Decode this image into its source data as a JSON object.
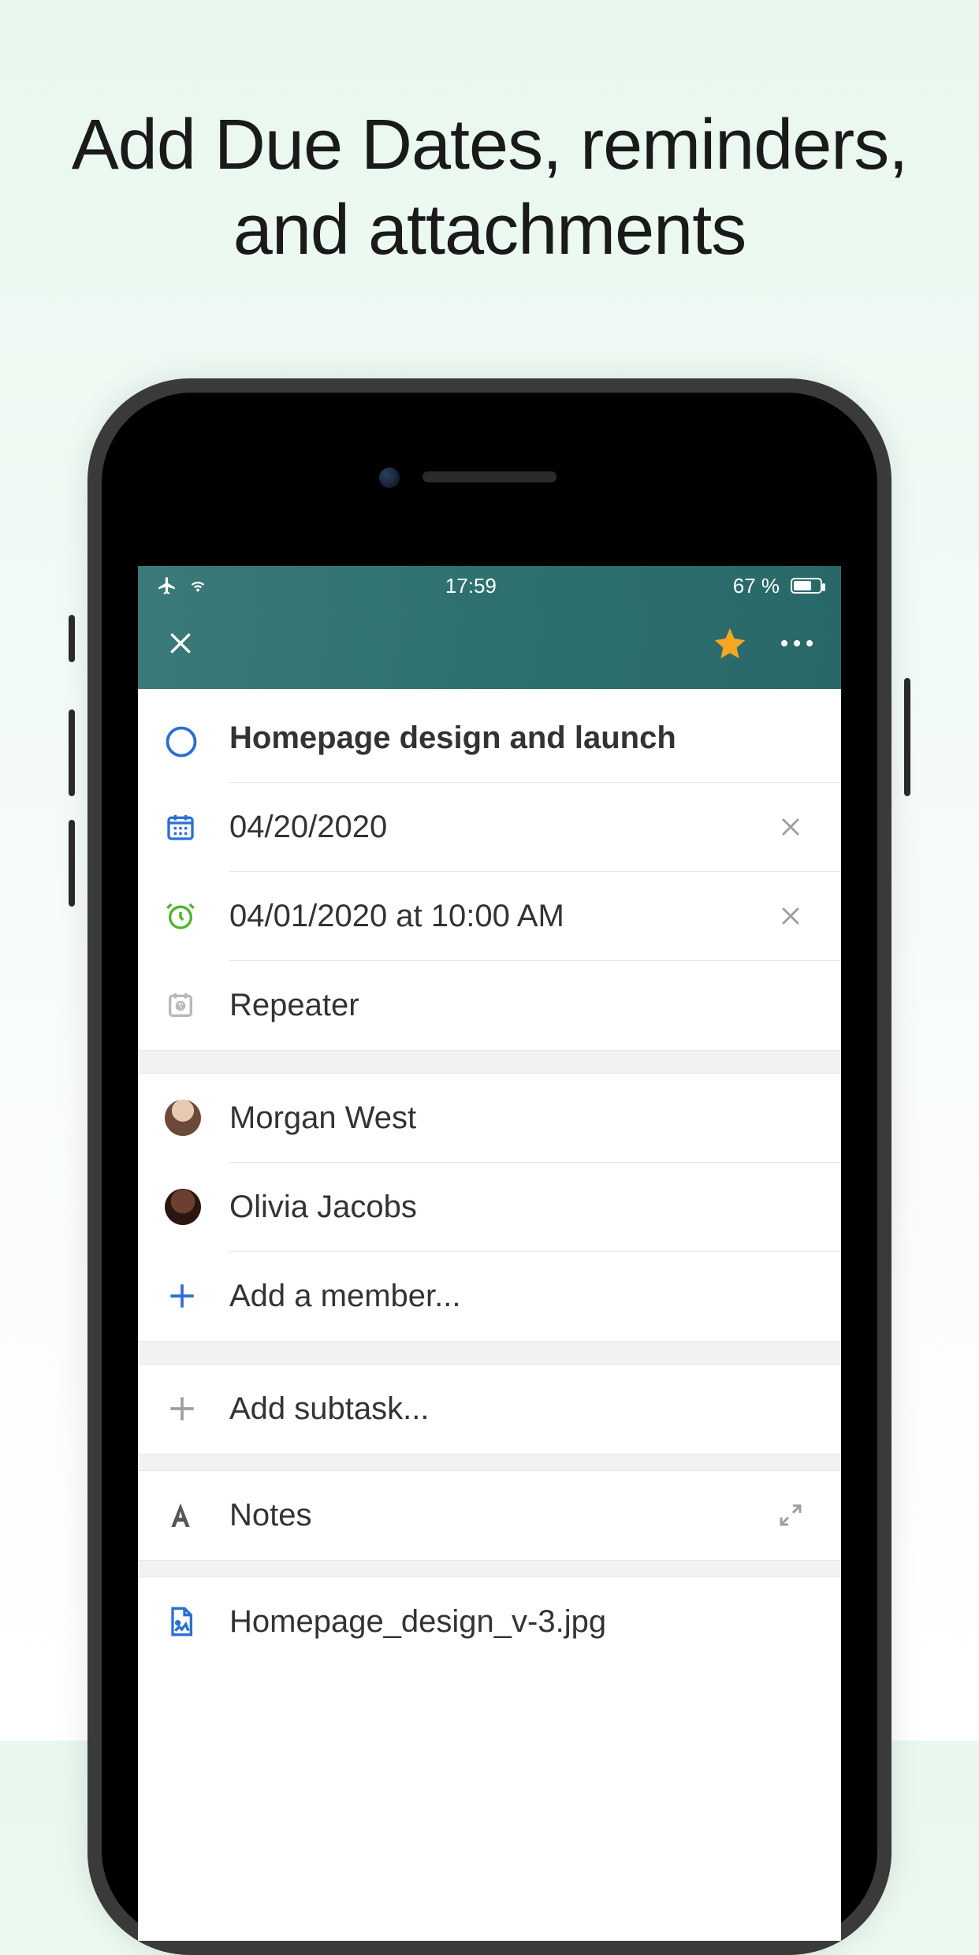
{
  "promo": {
    "line1": "Add Due Dates, reminders,",
    "line2": "and attachments"
  },
  "status": {
    "time": "17:59",
    "battery_label": "67 %"
  },
  "nav": {
    "starred": true
  },
  "task": {
    "title": "Homepage design and launch",
    "due_date": "04/20/2020",
    "reminder": "04/01/2020 at 10:00 AM",
    "repeater_placeholder": "Repeater"
  },
  "members": [
    {
      "name": "Morgan West"
    },
    {
      "name": "Olivia Jacobs"
    }
  ],
  "actions": {
    "add_member": "Add a member...",
    "add_subtask": "Add subtask...",
    "notes": "Notes"
  },
  "attachments": [
    {
      "filename": "Homepage_design_v-3.jpg"
    }
  ],
  "colors": {
    "accent_blue": "#2b6fd6",
    "star_orange": "#f5a623",
    "reminder_green": "#51b429"
  }
}
